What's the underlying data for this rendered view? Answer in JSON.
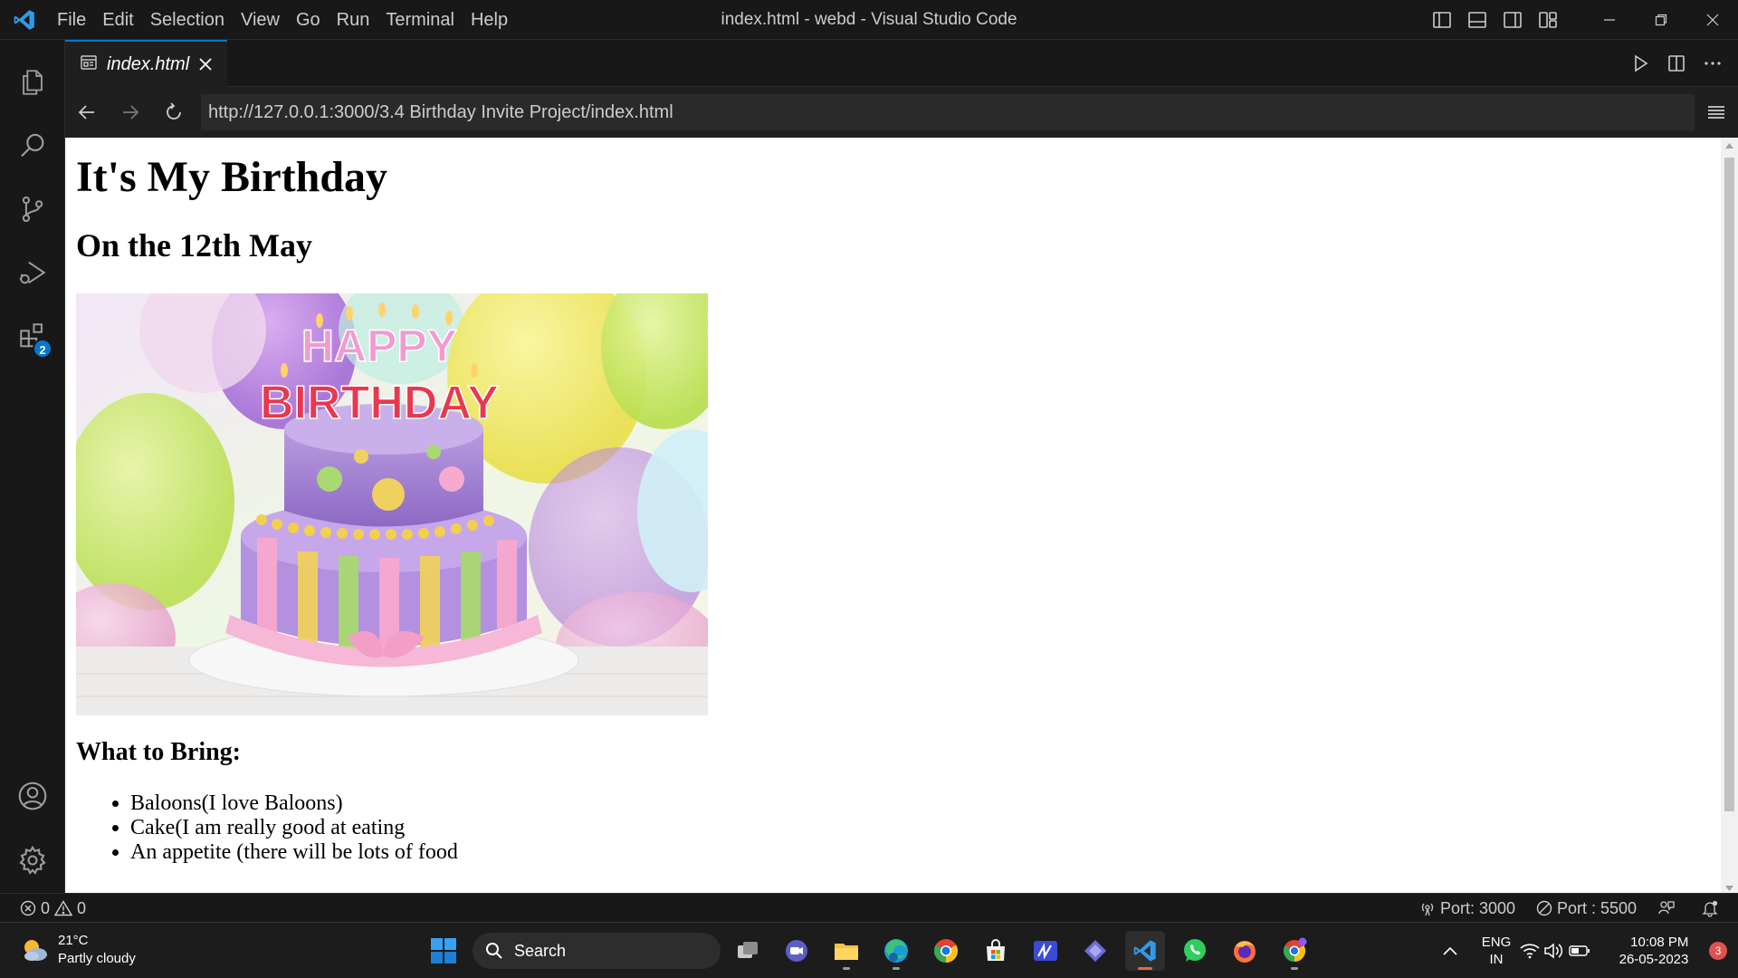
{
  "window_title": "index.html - webd - Visual Studio Code",
  "menu": [
    "File",
    "Edit",
    "Selection",
    "View",
    "Go",
    "Run",
    "Terminal",
    "Help"
  ],
  "activity_bar": {
    "extensions_badge": "2"
  },
  "tab": {
    "label": "index.html"
  },
  "browser": {
    "url": "http://127.0.0.1:3000/3.4 Birthday Invite Project/index.html"
  },
  "page": {
    "heading": "It's My Birthday",
    "subheading": "On the 12th May",
    "bring_heading": "What to Bring:",
    "bring_items": [
      "Baloons(I love Baloons)",
      "Cake(I am really good at eating",
      "An appetite (there will be lots of food"
    ],
    "cake_text_line1": "HAPPY",
    "cake_text_line2": "BIRTHDAY"
  },
  "status_bar": {
    "errors": "0",
    "warnings": "0",
    "port_forward": "Port: 3000",
    "live_server": "Port : 5500"
  },
  "taskbar": {
    "temperature": "21°C",
    "weather": "Partly cloudy",
    "search_label": "Search",
    "language": "ENG",
    "region": "IN",
    "time": "10:08 PM",
    "date": "26-05-2023",
    "notifications": "3"
  },
  "colors": {
    "accent": "#0078d4",
    "chrome_bg": "#181818",
    "editor_bg": "#1f1f1f"
  }
}
